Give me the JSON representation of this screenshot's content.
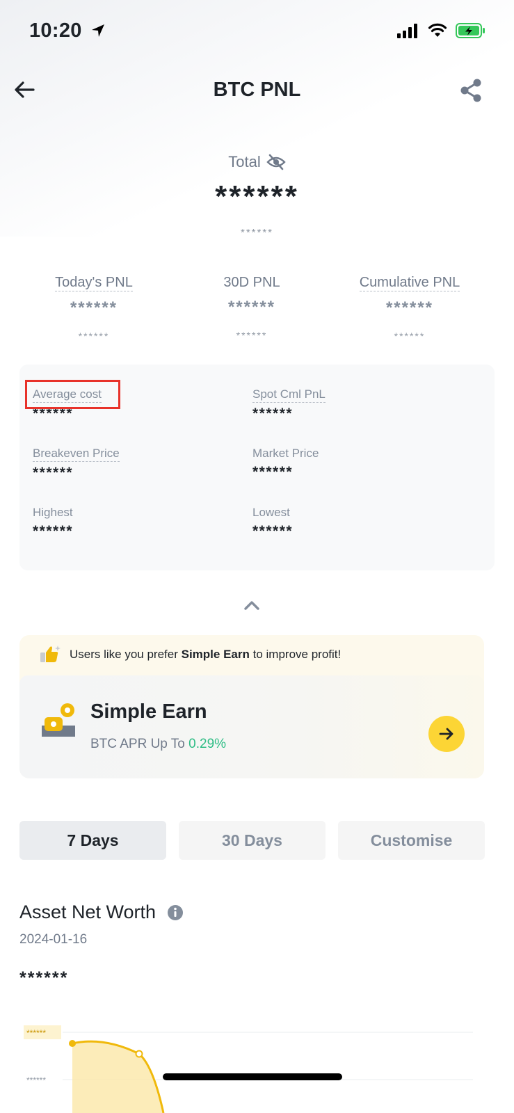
{
  "status_bar": {
    "time": "10:20"
  },
  "header": {
    "title": "BTC PNL"
  },
  "total": {
    "label": "Total",
    "value": "******",
    "sub_value": "******"
  },
  "pnl": [
    {
      "label": "Today's PNL",
      "value": "******",
      "sub": "******"
    },
    {
      "label": "30D PNL",
      "value": "******",
      "sub": "******"
    },
    {
      "label": "Cumulative PNL",
      "value": "******",
      "sub": "******"
    }
  ],
  "details": {
    "average_cost": {
      "label": "Average cost",
      "value": "******"
    },
    "spot_cml_pnl": {
      "label": "Spot Cml PnL",
      "value": "******"
    },
    "breakeven_price": {
      "label": "Breakeven Price",
      "value": "******"
    },
    "market_price": {
      "label": "Market Price",
      "value": "******"
    },
    "highest": {
      "label": "Highest",
      "value": "******"
    },
    "lowest": {
      "label": "Lowest",
      "value": "******"
    }
  },
  "promo": {
    "hint_prefix": "Users like you prefer ",
    "hint_bold": "Simple Earn",
    "hint_suffix": " to improve profit!",
    "title": "Simple Earn",
    "subtitle_prefix": "BTC APR Up To ",
    "apr": "0.29%"
  },
  "tabs": [
    {
      "label": "7 Days",
      "active": true
    },
    {
      "label": "30 Days",
      "active": false
    },
    {
      "label": "Customise",
      "active": false
    }
  ],
  "asset_net_worth": {
    "title": "Asset Net Worth",
    "date": "2024-01-16",
    "value": "******"
  },
  "chart_data": {
    "type": "area",
    "y_tick_labels": [
      "******",
      "******"
    ],
    "series_color": "#f0b90b"
  },
  "colors": {
    "accent": "#fcd535",
    "positive": "#2ebd85",
    "highlight_box": "#e8322a"
  }
}
